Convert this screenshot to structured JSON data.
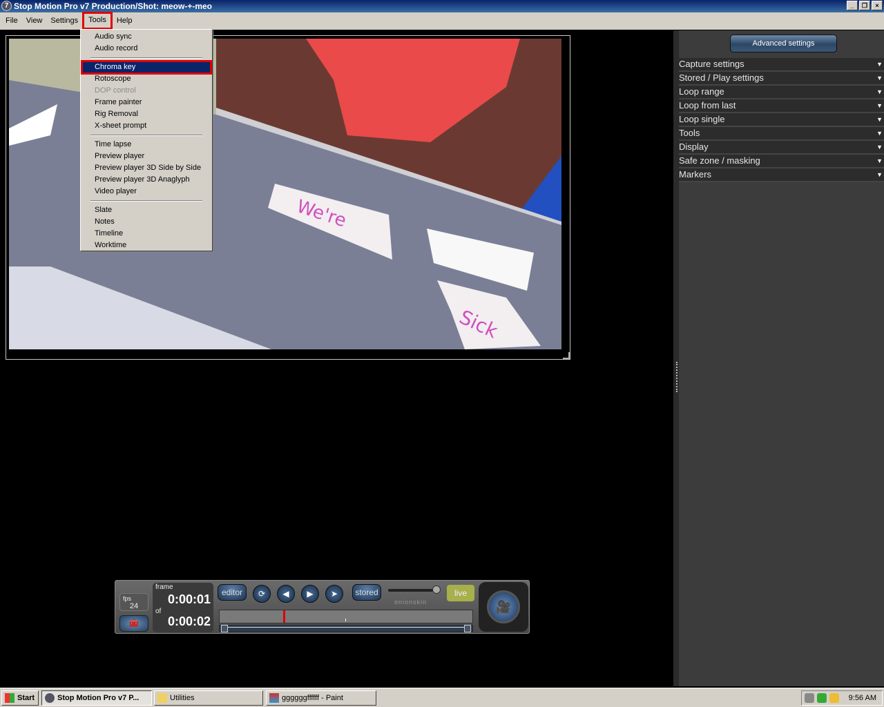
{
  "window": {
    "title": "Stop Motion Pro v7  Production/Shot: meow-+-meo",
    "controls": [
      "_",
      "❐",
      "×"
    ]
  },
  "menubar": [
    {
      "label": "File"
    },
    {
      "label": "View"
    },
    {
      "label": "Settings"
    },
    {
      "label": "Tools"
    },
    {
      "label": "Help"
    }
  ],
  "tools_menu": {
    "groups": [
      [
        {
          "label": "Audio sync"
        },
        {
          "label": "Audio record"
        }
      ],
      [
        {
          "label": "Chroma key",
          "selected": true
        },
        {
          "label": "Rotoscope"
        },
        {
          "label": "DOP control",
          "disabled": true
        },
        {
          "label": "Frame painter"
        },
        {
          "label": "Rig Removal"
        },
        {
          "label": "X-sheet prompt"
        }
      ],
      [
        {
          "label": "Time lapse"
        },
        {
          "label": "Preview player"
        },
        {
          "label": "Preview player 3D Side by Side"
        },
        {
          "label": "Preview player 3D Anaglyph"
        },
        {
          "label": "Video player"
        }
      ],
      [
        {
          "label": "Slate"
        },
        {
          "label": "Notes"
        },
        {
          "label": "Timeline"
        },
        {
          "label": "Worktime"
        }
      ]
    ]
  },
  "viewer": {
    "paper_texts": [
      "We're",
      "Sick"
    ]
  },
  "panel": {
    "advanced_label": "Advanced settings",
    "sections": [
      "Capture settings",
      "Stored / Play settings",
      "Loop range",
      "Loop from last",
      "Loop single",
      "Tools",
      "Display",
      "Safe zone / masking",
      "Markers"
    ]
  },
  "transport": {
    "fps_label": "fps",
    "fps": "24",
    "frame_label": "frame",
    "frame": "0:00:01",
    "of_label": "of",
    "total": "0:00:02",
    "editor": "editor",
    "stored": "stored",
    "live": "live",
    "onionskin": "onionskin",
    "onionskin_level": 1.0,
    "playhead_fraction": 0.25
  },
  "taskbar": {
    "start": "Start",
    "tasks": [
      {
        "label": "Stop Motion Pro v7  P..."
      },
      {
        "label": "Utilities"
      },
      {
        "label": "ggggggffffff - Paint"
      }
    ],
    "clock": "9:56 AM"
  }
}
